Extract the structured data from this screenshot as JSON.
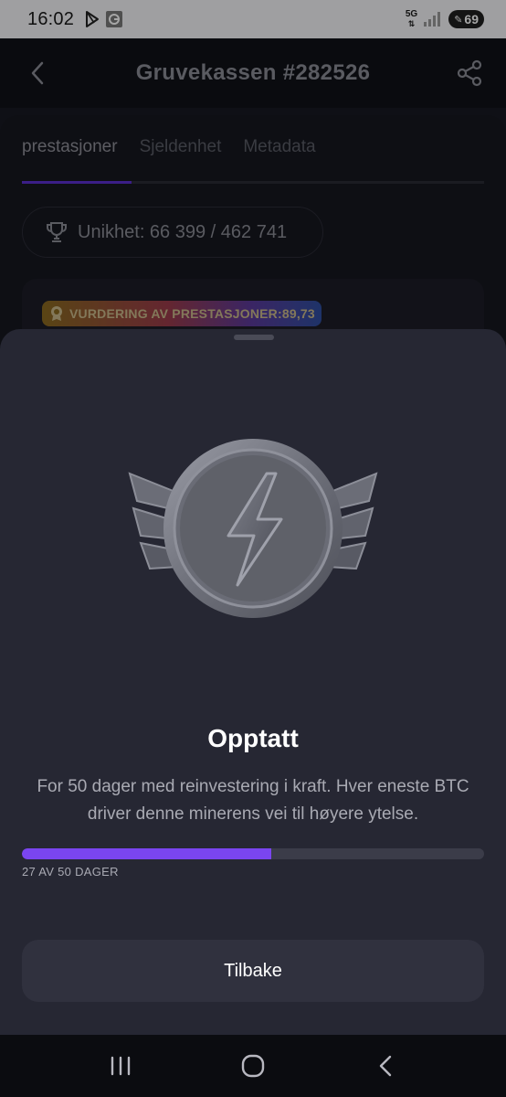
{
  "status_bar": {
    "time": "16:02",
    "network_type": "5G",
    "battery": "69",
    "icons": [
      "play-store-icon",
      "app-notification-icon",
      "network-5g-icon",
      "signal-icon",
      "battery-icon"
    ]
  },
  "header": {
    "title": "Gruvekassen #282526",
    "back_icon": "chevron-left-icon",
    "share_icon": "share-icon"
  },
  "tabs": [
    {
      "label": "prestasjoner",
      "active": true
    },
    {
      "label": "Sjeldenhet",
      "active": false
    },
    {
      "label": "Metadata",
      "active": false
    }
  ],
  "uniqueness": {
    "icon": "trophy-icon",
    "text": "Unikhet: 66 399 / 462 741"
  },
  "rating": {
    "icon": "award-icon",
    "text": "VURDERING AV PRESTASJONER:89,73"
  },
  "sheet": {
    "medal_icon": "lightning-medal-icon",
    "title": "Opptatt",
    "description": "For 50 dager med reinvestering i kraft. Hver eneste BTC driver denne minerens vei til høyere ytelse.",
    "progress": {
      "current": 27,
      "total": 50,
      "label": "27 AV 50 DAGER"
    },
    "back_button": "Tilbake"
  },
  "nav_bar": {
    "icons": [
      "recent-apps-icon",
      "home-icon",
      "back-icon"
    ]
  },
  "colors": {
    "accent": "#7a45f0",
    "sheet_bg": "#262733",
    "button_bg": "#30313e"
  }
}
